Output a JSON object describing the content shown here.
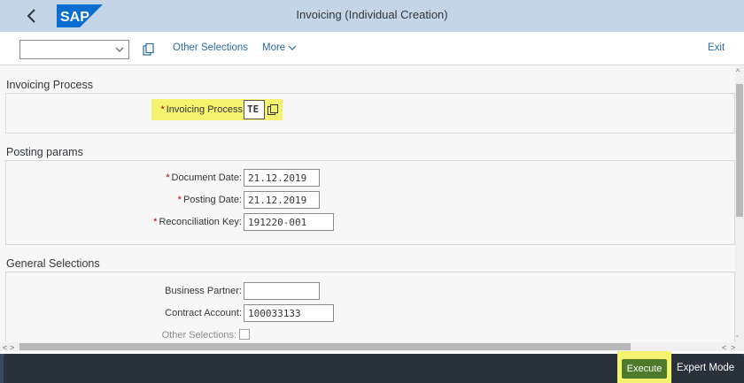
{
  "shell": {
    "title": "Invoicing (Individual Creation)",
    "logo_text": "SAP",
    "back_icon": "chevron-left-icon",
    "brand_color": "#0a6ed1"
  },
  "toolbar": {
    "variant_value": "",
    "other_selections": "Other Selections",
    "more": "More",
    "exit": "Exit"
  },
  "sections": {
    "invoicing_process": {
      "title": "Invoicing Process",
      "label": "Invoicing Process:",
      "value": "TE"
    },
    "posting_params": {
      "title": "Posting params",
      "document_date_label": "Document Date:",
      "document_date_value": "21.12.2019",
      "posting_date_label": "Posting Date:",
      "posting_date_value": "21.12.2019",
      "reconciliation_key_label": "Reconciliation Key:",
      "reconciliation_key_value": "191220-001"
    },
    "general_selections": {
      "title": "General Selections",
      "business_partner_label": "Business Partner:",
      "business_partner_value": "",
      "contract_account_label": "Contract Account:",
      "contract_account_value": "100033133",
      "other_selections_label": "Other Selections:",
      "other_selections_checked": false
    }
  },
  "footer": {
    "execute": "Execute",
    "expert_mode": "Expert Mode",
    "execute_color": "#4d7a2b",
    "highlight_color": "#f5f26d"
  },
  "required_mark": "*"
}
